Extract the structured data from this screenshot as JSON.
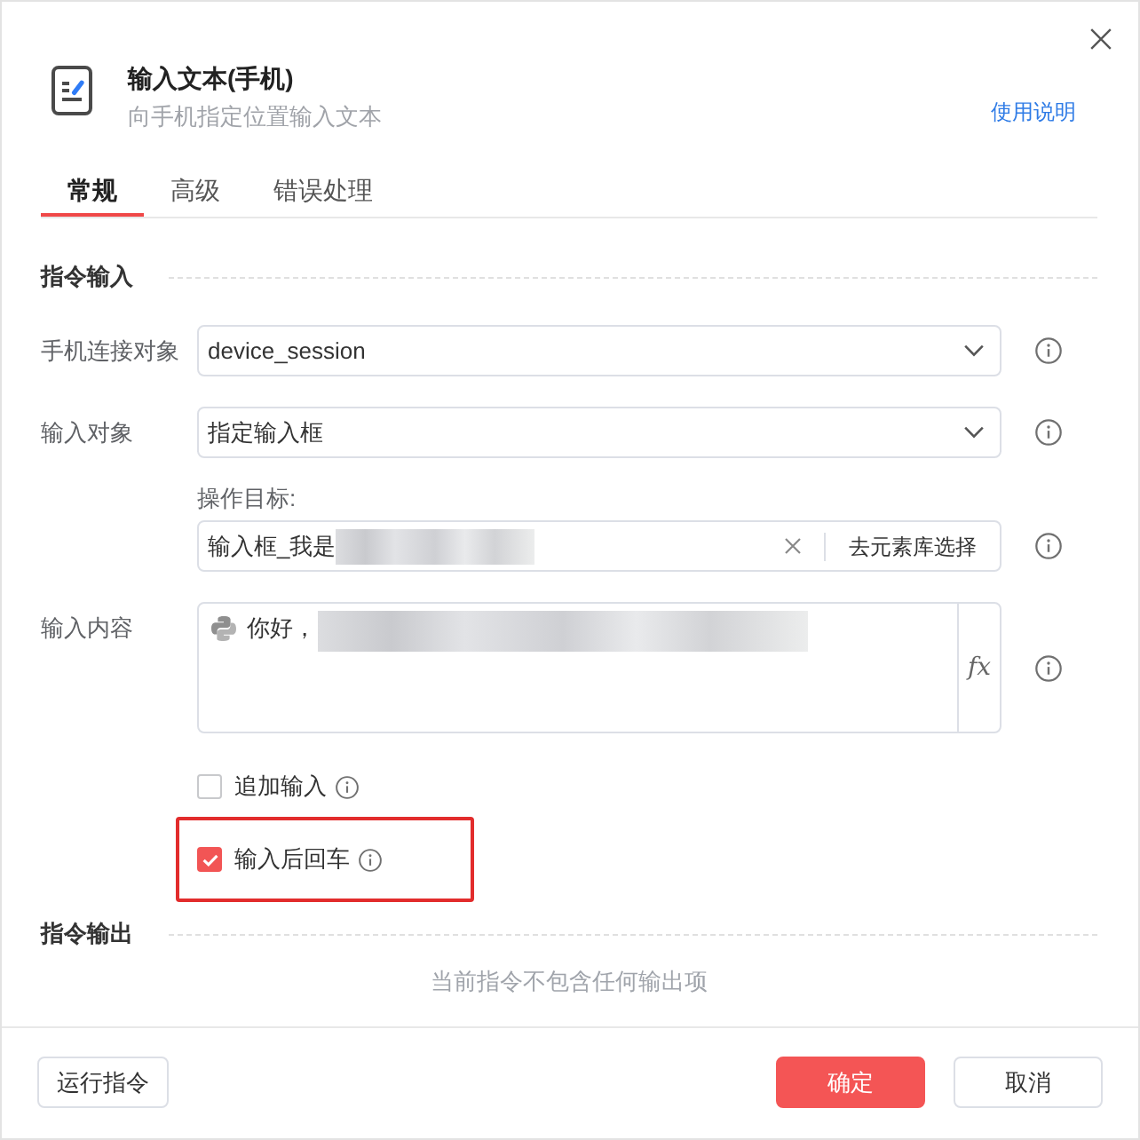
{
  "dialog": {
    "title": "输入文本(手机)",
    "subtitle": "向手机指定位置输入文本",
    "help_link": "使用说明"
  },
  "tabs": [
    {
      "label": "常规",
      "selected": true
    },
    {
      "label": "高级",
      "selected": false
    },
    {
      "label": "错误处理",
      "selected": false
    }
  ],
  "input_section": {
    "title": "指令输入",
    "fields": [
      {
        "kind": "select",
        "label": "手机连接对象",
        "value": "device_session"
      },
      {
        "kind": "select",
        "label": "输入对象",
        "value": "指定输入框"
      },
      {
        "kind": "target",
        "label": "操作目标:",
        "value": "输入框_我是",
        "redacted": true,
        "button": "去元素库选择"
      },
      {
        "kind": "textarea",
        "label": "输入内容",
        "value": "你好，",
        "redacted": true,
        "formula_button": "fx"
      }
    ],
    "options": [
      {
        "label": "追加输入",
        "checked": false,
        "highlighted": false
      },
      {
        "label": "输入后回车",
        "checked": true,
        "highlighted": true
      }
    ]
  },
  "output_section": {
    "title": "指令输出",
    "empty_text": "当前指令不包含任何输出项"
  },
  "footer": {
    "left_buttons": [
      {
        "label": "运行指令",
        "kind": "default"
      }
    ],
    "right_buttons": [
      {
        "label": "确定",
        "kind": "primary"
      },
      {
        "label": "取消",
        "kind": "default"
      }
    ]
  }
}
